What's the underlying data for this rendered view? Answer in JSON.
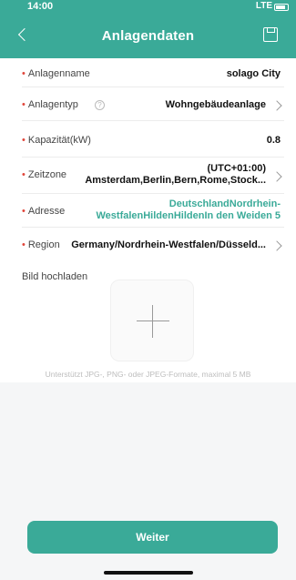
{
  "status_bar": {
    "time": "14:00",
    "signal": "LTE"
  },
  "header": {
    "title": "Anlagendaten"
  },
  "form": {
    "rows": [
      {
        "label": "Anlagenname",
        "value": "solago City"
      },
      {
        "label": "Anlagentyp",
        "value": "Wohngebäudeanlage"
      },
      {
        "label": "Kapazität(kW)",
        "value": "0.8"
      },
      {
        "label": "Zeitzone",
        "value_line1": "(UTC+01:00)",
        "value_line2": "Amsterdam,Berlin,Bern,Rome,Stock..."
      },
      {
        "label": "Adresse",
        "value_line1": "DeutschlandNordrhein-",
        "value_line2": "WestfalenHildenHildenIn den Weiden 5"
      },
      {
        "label": "Region",
        "value": "Germany/Nordrhein-Westfalen/Düsseld..."
      }
    ]
  },
  "upload": {
    "title": "Bild hochladen",
    "hint": "Unterstützt JPG-, PNG- oder JPEG-Formate, maximal 5 MB"
  },
  "footer": {
    "next_label": "Weiter"
  },
  "colors": {
    "accent": "#3aaa98",
    "required": "#e0463b"
  },
  "icons": [
    "back-icon",
    "save-icon",
    "help-icon",
    "chevron-right-icon",
    "plus-icon"
  ]
}
